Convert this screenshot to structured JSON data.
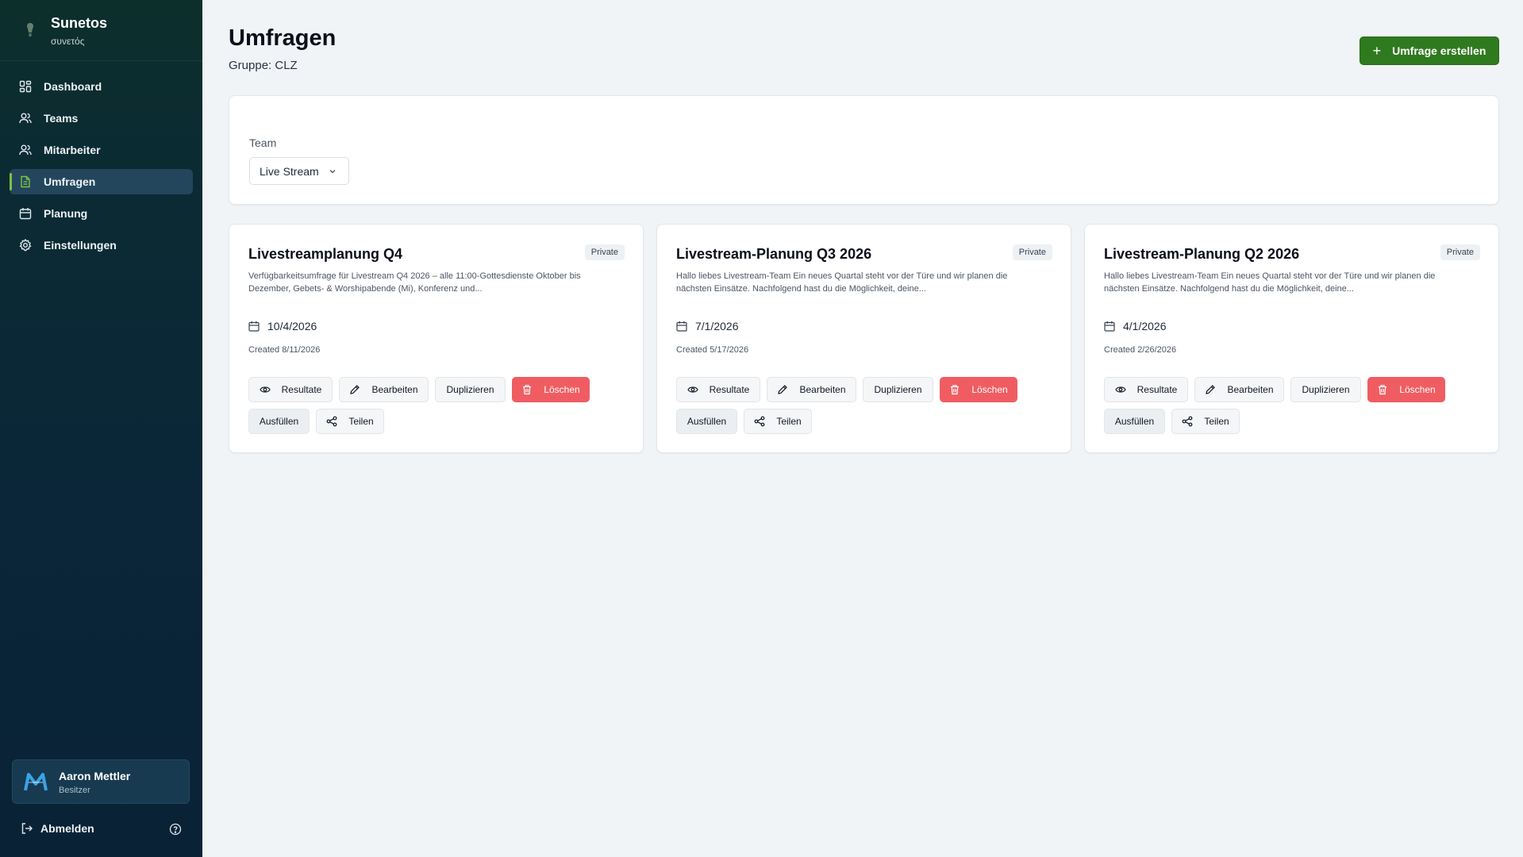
{
  "app": {
    "name": "Sunetos",
    "subtitle": "συνετός"
  },
  "sidebar": {
    "items": [
      {
        "label": "Dashboard",
        "icon": "dashboard-icon",
        "active": false
      },
      {
        "label": "Teams",
        "icon": "users-icon",
        "active": false
      },
      {
        "label": "Mitarbeiter",
        "icon": "users-icon",
        "active": false
      },
      {
        "label": "Umfragen",
        "icon": "document-icon",
        "active": true
      },
      {
        "label": "Planung",
        "icon": "calendar-icon",
        "active": false
      },
      {
        "label": "Einstellungen",
        "icon": "gear-icon",
        "active": false
      }
    ],
    "user": {
      "name": "Aaron Mettler",
      "role": "Besitzer"
    },
    "logout_label": "Abmelden"
  },
  "page": {
    "title": "Umfragen",
    "subtitle": "Gruppe: CLZ",
    "create_label": "Umfrage erstellen"
  },
  "filter": {
    "label": "Team",
    "value": "Live Stream"
  },
  "surveys": [
    {
      "title": "Livestreamplanung Q4",
      "badge": "Private",
      "description": "Verfügbarkeitsumfrage für Livestream Q4 2026 – alle 11:00-Gottesdienste Oktober bis Dezember, Gebets- & Worshipabende (Mi), Konferenz und...",
      "date": "10/4/2026",
      "created": "Created 8/11/2026"
    },
    {
      "title": "Livestream-Planung Q3 2026",
      "badge": "Private",
      "description": "Hallo liebes Livestream-Team Ein neues Quartal steht vor der Türe und wir planen die nächsten Einsätze. Nachfolgend hast du die Möglichkeit, deine...",
      "date": "7/1/2026",
      "created": "Created 5/17/2026"
    },
    {
      "title": "Livestream-Planung Q2 2026",
      "badge": "Private",
      "description": "Hallo liebes Livestream-Team Ein neues Quartal steht vor der Türe und wir planen die nächsten Einsätze. Nachfolgend hast du die Möglichkeit, deine...",
      "date": "4/1/2026",
      "created": "Created 2/26/2026"
    }
  ],
  "actions": {
    "results": "Resultate",
    "edit": "Bearbeiten",
    "duplicate": "Duplizieren",
    "delete": "Löschen",
    "fill": "Ausfüllen",
    "share": "Teilen"
  },
  "colors": {
    "primary_green": "#2f7a1e",
    "danger": "#ef5d62",
    "sidebar_active": "#23465d",
    "active_indicator": "#7cc242"
  }
}
